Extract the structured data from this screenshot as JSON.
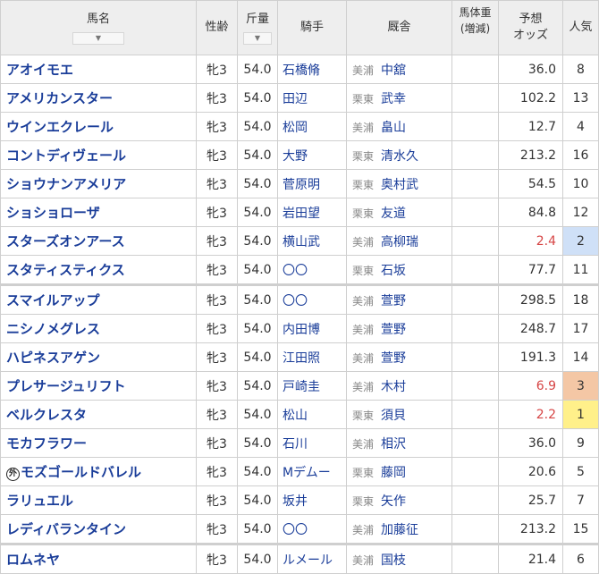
{
  "headers": {
    "name": "馬名",
    "sex_age": "性齢",
    "weight": "斤量",
    "jockey": "騎手",
    "stable": "厩舎",
    "body_weight": "馬体重",
    "body_weight_sub": "(増減)",
    "odds_line1": "予想",
    "odds_line2": "オッズ",
    "popularity_line1": "人",
    "popularity_line2": "気",
    "sort_icon": "chevron-down-icon"
  },
  "highlight_colors": {
    "popularity_1": "#fff08a",
    "popularity_2": "#cfe0f7",
    "popularity_3": "#f4c7a5",
    "hot_odds": "#d64545",
    "link": "#1a3d99"
  },
  "rows": [
    {
      "name": "アオイモエ",
      "sex_age": "牝3",
      "weight": "54.0",
      "jockey": "石橋脩",
      "region": "美浦",
      "trainer": "中舘",
      "body_weight": "",
      "odds": "36.0",
      "popularity": "8"
    },
    {
      "name": "アメリカンスター",
      "sex_age": "牝3",
      "weight": "54.0",
      "jockey": "田辺",
      "region": "栗東",
      "trainer": "武幸",
      "body_weight": "",
      "odds": "102.2",
      "popularity": "13"
    },
    {
      "name": "ウインエクレール",
      "sex_age": "牝3",
      "weight": "54.0",
      "jockey": "松岡",
      "region": "美浦",
      "trainer": "畠山",
      "body_weight": "",
      "odds": "12.7",
      "popularity": "4"
    },
    {
      "name": "コントディヴェール",
      "sex_age": "牝3",
      "weight": "54.0",
      "jockey": "大野",
      "region": "栗東",
      "trainer": "清水久",
      "body_weight": "",
      "odds": "213.2",
      "popularity": "16"
    },
    {
      "name": "ショウナンアメリア",
      "sex_age": "牝3",
      "weight": "54.0",
      "jockey": "菅原明",
      "region": "栗東",
      "trainer": "奥村武",
      "body_weight": "",
      "odds": "54.5",
      "popularity": "10"
    },
    {
      "name": "ショショローザ",
      "sex_age": "牝3",
      "weight": "54.0",
      "jockey": "岩田望",
      "region": "栗東",
      "trainer": "友道",
      "body_weight": "",
      "odds": "84.8",
      "popularity": "12"
    },
    {
      "name": "スターズオンアース",
      "sex_age": "牝3",
      "weight": "54.0",
      "jockey": "横山武",
      "region": "美浦",
      "trainer": "高柳瑞",
      "body_weight": "",
      "odds": "2.4",
      "popularity": "2"
    },
    {
      "name": "スタティスティクス",
      "sex_age": "牝3",
      "weight": "54.0",
      "jockey": "〇〇",
      "region": "栗東",
      "trainer": "石坂",
      "body_weight": "",
      "odds": "77.7",
      "popularity": "11"
    },
    {
      "name": "スマイルアップ",
      "sex_age": "牝3",
      "weight": "54.0",
      "jockey": "〇〇",
      "region": "美浦",
      "trainer": "萱野",
      "body_weight": "",
      "odds": "298.5",
      "popularity": "18"
    },
    {
      "name": "ニシノメグレス",
      "sex_age": "牝3",
      "weight": "54.0",
      "jockey": "内田博",
      "region": "美浦",
      "trainer": "萱野",
      "body_weight": "",
      "odds": "248.7",
      "popularity": "17"
    },
    {
      "name": "ハピネスアゲン",
      "sex_age": "牝3",
      "weight": "54.0",
      "jockey": "江田照",
      "region": "美浦",
      "trainer": "萱野",
      "body_weight": "",
      "odds": "191.3",
      "popularity": "14"
    },
    {
      "name": "プレサージュリフト",
      "sex_age": "牝3",
      "weight": "54.0",
      "jockey": "戸崎圭",
      "region": "美浦",
      "trainer": "木村",
      "body_weight": "",
      "odds": "6.9",
      "popularity": "3"
    },
    {
      "name": "ベルクレスタ",
      "sex_age": "牝3",
      "weight": "54.0",
      "jockey": "松山",
      "region": "栗東",
      "trainer": "須貝",
      "body_weight": "",
      "odds": "2.2",
      "popularity": "1"
    },
    {
      "name": "モカフラワー",
      "sex_age": "牝3",
      "weight": "54.0",
      "jockey": "石川",
      "region": "美浦",
      "trainer": "相沢",
      "body_weight": "",
      "odds": "36.0",
      "popularity": "9"
    },
    {
      "name": "モズゴールドバレル",
      "foreign": "外",
      "sex_age": "牝3",
      "weight": "54.0",
      "jockey": "Mデムー",
      "region": "栗東",
      "trainer": "藤岡",
      "body_weight": "",
      "odds": "20.6",
      "popularity": "5"
    },
    {
      "name": "ラリュエル",
      "sex_age": "牝3",
      "weight": "54.0",
      "jockey": "坂井",
      "region": "栗東",
      "trainer": "矢作",
      "body_weight": "",
      "odds": "25.7",
      "popularity": "7"
    },
    {
      "name": "レディバランタイン",
      "sex_age": "牝3",
      "weight": "54.0",
      "jockey": "〇〇",
      "region": "美浦",
      "trainer": "加藤征",
      "body_weight": "",
      "odds": "213.2",
      "popularity": "15"
    },
    {
      "name": "ロムネヤ",
      "sex_age": "牝3",
      "weight": "54.0",
      "jockey": "ルメール",
      "region": "美浦",
      "trainer": "国枝",
      "body_weight": "",
      "odds": "21.4",
      "popularity": "6"
    }
  ]
}
